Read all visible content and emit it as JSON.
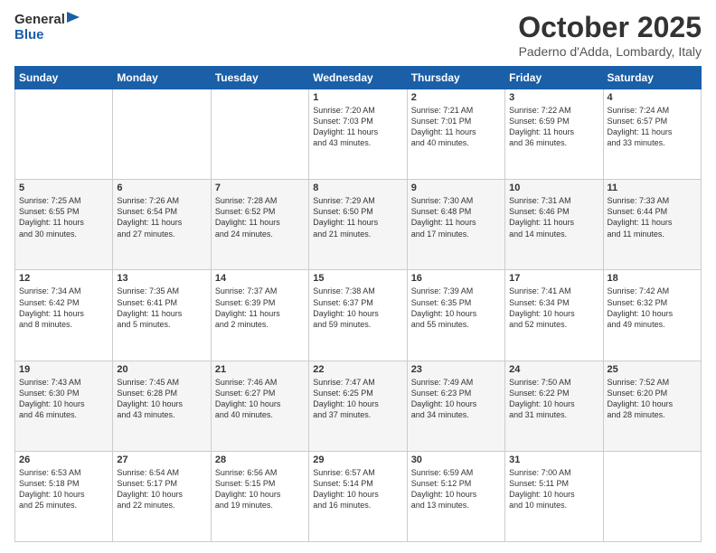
{
  "logo": {
    "general": "General",
    "blue": "Blue"
  },
  "header": {
    "month": "October 2025",
    "location": "Paderno d'Adda, Lombardy, Italy"
  },
  "days_of_week": [
    "Sunday",
    "Monday",
    "Tuesday",
    "Wednesday",
    "Thursday",
    "Friday",
    "Saturday"
  ],
  "weeks": [
    [
      {
        "day": "",
        "info": ""
      },
      {
        "day": "",
        "info": ""
      },
      {
        "day": "",
        "info": ""
      },
      {
        "day": "1",
        "info": "Sunrise: 7:20 AM\nSunset: 7:03 PM\nDaylight: 11 hours\nand 43 minutes."
      },
      {
        "day": "2",
        "info": "Sunrise: 7:21 AM\nSunset: 7:01 PM\nDaylight: 11 hours\nand 40 minutes."
      },
      {
        "day": "3",
        "info": "Sunrise: 7:22 AM\nSunset: 6:59 PM\nDaylight: 11 hours\nand 36 minutes."
      },
      {
        "day": "4",
        "info": "Sunrise: 7:24 AM\nSunset: 6:57 PM\nDaylight: 11 hours\nand 33 minutes."
      }
    ],
    [
      {
        "day": "5",
        "info": "Sunrise: 7:25 AM\nSunset: 6:55 PM\nDaylight: 11 hours\nand 30 minutes."
      },
      {
        "day": "6",
        "info": "Sunrise: 7:26 AM\nSunset: 6:54 PM\nDaylight: 11 hours\nand 27 minutes."
      },
      {
        "day": "7",
        "info": "Sunrise: 7:28 AM\nSunset: 6:52 PM\nDaylight: 11 hours\nand 24 minutes."
      },
      {
        "day": "8",
        "info": "Sunrise: 7:29 AM\nSunset: 6:50 PM\nDaylight: 11 hours\nand 21 minutes."
      },
      {
        "day": "9",
        "info": "Sunrise: 7:30 AM\nSunset: 6:48 PM\nDaylight: 11 hours\nand 17 minutes."
      },
      {
        "day": "10",
        "info": "Sunrise: 7:31 AM\nSunset: 6:46 PM\nDaylight: 11 hours\nand 14 minutes."
      },
      {
        "day": "11",
        "info": "Sunrise: 7:33 AM\nSunset: 6:44 PM\nDaylight: 11 hours\nand 11 minutes."
      }
    ],
    [
      {
        "day": "12",
        "info": "Sunrise: 7:34 AM\nSunset: 6:42 PM\nDaylight: 11 hours\nand 8 minutes."
      },
      {
        "day": "13",
        "info": "Sunrise: 7:35 AM\nSunset: 6:41 PM\nDaylight: 11 hours\nand 5 minutes."
      },
      {
        "day": "14",
        "info": "Sunrise: 7:37 AM\nSunset: 6:39 PM\nDaylight: 11 hours\nand 2 minutes."
      },
      {
        "day": "15",
        "info": "Sunrise: 7:38 AM\nSunset: 6:37 PM\nDaylight: 10 hours\nand 59 minutes."
      },
      {
        "day": "16",
        "info": "Sunrise: 7:39 AM\nSunset: 6:35 PM\nDaylight: 10 hours\nand 55 minutes."
      },
      {
        "day": "17",
        "info": "Sunrise: 7:41 AM\nSunset: 6:34 PM\nDaylight: 10 hours\nand 52 minutes."
      },
      {
        "day": "18",
        "info": "Sunrise: 7:42 AM\nSunset: 6:32 PM\nDaylight: 10 hours\nand 49 minutes."
      }
    ],
    [
      {
        "day": "19",
        "info": "Sunrise: 7:43 AM\nSunset: 6:30 PM\nDaylight: 10 hours\nand 46 minutes."
      },
      {
        "day": "20",
        "info": "Sunrise: 7:45 AM\nSunset: 6:28 PM\nDaylight: 10 hours\nand 43 minutes."
      },
      {
        "day": "21",
        "info": "Sunrise: 7:46 AM\nSunset: 6:27 PM\nDaylight: 10 hours\nand 40 minutes."
      },
      {
        "day": "22",
        "info": "Sunrise: 7:47 AM\nSunset: 6:25 PM\nDaylight: 10 hours\nand 37 minutes."
      },
      {
        "day": "23",
        "info": "Sunrise: 7:49 AM\nSunset: 6:23 PM\nDaylight: 10 hours\nand 34 minutes."
      },
      {
        "day": "24",
        "info": "Sunrise: 7:50 AM\nSunset: 6:22 PM\nDaylight: 10 hours\nand 31 minutes."
      },
      {
        "day": "25",
        "info": "Sunrise: 7:52 AM\nSunset: 6:20 PM\nDaylight: 10 hours\nand 28 minutes."
      }
    ],
    [
      {
        "day": "26",
        "info": "Sunrise: 6:53 AM\nSunset: 5:18 PM\nDaylight: 10 hours\nand 25 minutes."
      },
      {
        "day": "27",
        "info": "Sunrise: 6:54 AM\nSunset: 5:17 PM\nDaylight: 10 hours\nand 22 minutes."
      },
      {
        "day": "28",
        "info": "Sunrise: 6:56 AM\nSunset: 5:15 PM\nDaylight: 10 hours\nand 19 minutes."
      },
      {
        "day": "29",
        "info": "Sunrise: 6:57 AM\nSunset: 5:14 PM\nDaylight: 10 hours\nand 16 minutes."
      },
      {
        "day": "30",
        "info": "Sunrise: 6:59 AM\nSunset: 5:12 PM\nDaylight: 10 hours\nand 13 minutes."
      },
      {
        "day": "31",
        "info": "Sunrise: 7:00 AM\nSunset: 5:11 PM\nDaylight: 10 hours\nand 10 minutes."
      },
      {
        "day": "",
        "info": ""
      }
    ]
  ]
}
